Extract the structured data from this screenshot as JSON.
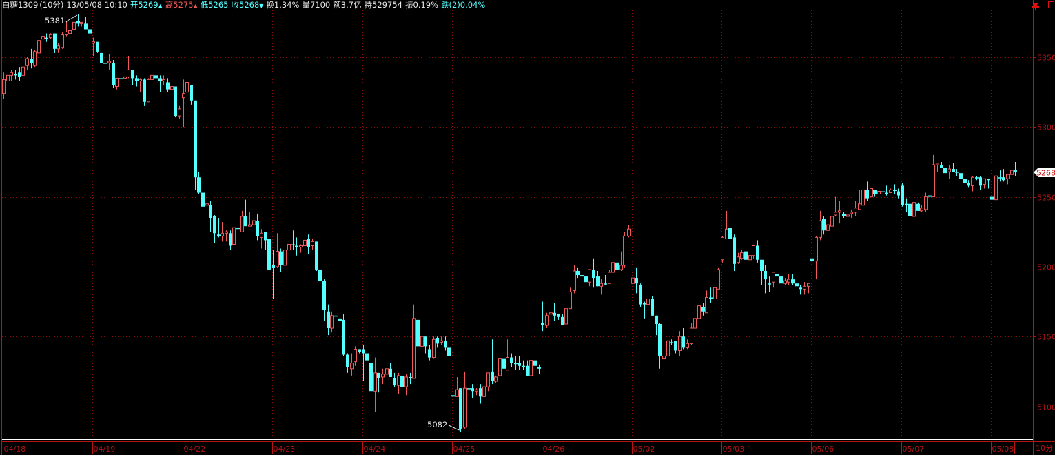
{
  "header": {
    "symbol": "白糖1309",
    "period": "(10分)",
    "datetime": "13/05/08 10:10",
    "open": "开5269",
    "high": "高5275",
    "low": "低5265",
    "close": "收5268",
    "turnover_rate": "换1.34%",
    "volume": "量7100",
    "amount": "额3.7亿",
    "open_interest": "持529754",
    "amplitude": "振0.19%",
    "change": "跌(2)0.04%"
  },
  "period_label": "10分",
  "current_price_tag": "5268",
  "icons": [
    "pin-icon",
    "window-icon"
  ],
  "colors": {
    "up": "#f05a5a",
    "down": "#54ffff",
    "grid": "#8a0d0d",
    "axis": "#b41414",
    "background": "#000000"
  },
  "chart_data": {
    "type": "candlestick",
    "title": "",
    "x_tick_labels": [
      "04/18",
      "04/19",
      "04/22",
      "04/23",
      "04/24",
      "04/25",
      "04/26",
      "05/02",
      "05/03",
      "05/06",
      "05/07",
      "05/08"
    ],
    "bars_per_day": 23,
    "y_tick_labels": [
      "5350",
      "5300",
      "5250",
      "5200",
      "5150",
      "5100"
    ],
    "ylim": [
      5076,
      5384
    ],
    "grid": true,
    "annotations": {
      "max_label": "5381",
      "min_label": "5082"
    },
    "ohlc_fields": [
      "open",
      "high",
      "low",
      "close"
    ],
    "candles": [
      [
        5324,
        5339,
        5320,
        5334
      ],
      [
        5333,
        5342,
        5328,
        5337
      ],
      [
        5337,
        5341,
        5333,
        5339
      ],
      [
        5338,
        5341,
        5334,
        5337
      ],
      [
        5339,
        5343,
        5333,
        5336
      ],
      [
        5337,
        5344,
        5336,
        5343
      ],
      [
        5344,
        5350,
        5341,
        5349
      ],
      [
        5349,
        5356,
        5342,
        5346
      ],
      [
        5344,
        5355,
        5343,
        5354
      ],
      [
        5353,
        5367,
        5352,
        5362
      ],
      [
        5363,
        5372,
        5362,
        5365
      ],
      [
        5364,
        5367,
        5361,
        5364
      ],
      [
        5364,
        5367,
        5363,
        5366
      ],
      [
        5367,
        5367,
        5353,
        5356
      ],
      [
        5356,
        5360,
        5353,
        5358
      ],
      [
        5357,
        5368,
        5356,
        5366
      ],
      [
        5366,
        5376,
        5365,
        5368
      ],
      [
        5367,
        5370,
        5367,
        5369
      ],
      [
        5370,
        5379,
        5369,
        5375
      ],
      [
        5376,
        5381,
        5372,
        5374
      ],
      [
        5374,
        5375,
        5372,
        5375
      ],
      [
        5374,
        5379,
        5370,
        5370
      ],
      [
        5370,
        5371,
        5366,
        5367
      ],
      [
        5360,
        5364,
        5351,
        5361
      ],
      [
        5361,
        5361,
        5353,
        5354
      ],
      [
        5353,
        5353,
        5346,
        5346
      ],
      [
        5346,
        5349,
        5343,
        5346
      ],
      [
        5346,
        5352,
        5341,
        5347
      ],
      [
        5346,
        5348,
        5328,
        5330
      ],
      [
        5329,
        5335,
        5327,
        5335
      ],
      [
        5335,
        5339,
        5334,
        5335
      ],
      [
        5335,
        5337,
        5329,
        5336
      ],
      [
        5336,
        5351,
        5335,
        5341
      ],
      [
        5341,
        5341,
        5330,
        5335
      ],
      [
        5335,
        5337,
        5329,
        5333
      ],
      [
        5333,
        5335,
        5325,
        5334
      ],
      [
        5334,
        5335,
        5315,
        5318
      ],
      [
        5318,
        5335,
        5318,
        5334
      ],
      [
        5334,
        5337,
        5327,
        5337
      ],
      [
        5337,
        5339,
        5333,
        5335
      ],
      [
        5335,
        5337,
        5325,
        5333
      ],
      [
        5333,
        5337,
        5330,
        5334
      ],
      [
        5332,
        5335,
        5325,
        5327
      ],
      [
        5327,
        5330,
        5324,
        5329
      ],
      [
        5329,
        5329,
        5307,
        5308
      ],
      [
        5308,
        5315,
        5306,
        5313
      ],
      [
        5321,
        5334,
        5300,
        5324
      ],
      [
        5325,
        5334,
        5324,
        5332
      ],
      [
        5330,
        5330,
        5316,
        5319
      ],
      [
        5319,
        5319,
        5255,
        5264
      ],
      [
        5264,
        5268,
        5252,
        5253
      ],
      [
        5253,
        5258,
        5242,
        5243
      ],
      [
        5244,
        5253,
        5237,
        5245
      ],
      [
        5244,
        5247,
        5225,
        5235
      ],
      [
        5236,
        5237,
        5217,
        5224
      ],
      [
        5223,
        5235,
        5221,
        5222
      ],
      [
        5222,
        5232,
        5218,
        5224
      ],
      [
        5224,
        5226,
        5218,
        5225
      ],
      [
        5224,
        5226,
        5212,
        5215
      ],
      [
        5216,
        5229,
        5209,
        5228
      ],
      [
        5228,
        5237,
        5224,
        5227
      ],
      [
        5225,
        5240,
        5225,
        5236
      ],
      [
        5236,
        5248,
        5229,
        5229
      ],
      [
        5229,
        5239,
        5229,
        5230
      ],
      [
        5230,
        5238,
        5228,
        5233
      ],
      [
        5233,
        5238,
        5219,
        5222
      ],
      [
        5221,
        5227,
        5213,
        5224
      ],
      [
        5225,
        5225,
        5212,
        5219
      ],
      [
        5220,
        5221,
        5196,
        5198
      ],
      [
        5201,
        5212,
        5177,
        5199
      ],
      [
        5200,
        5224,
        5199,
        5211
      ],
      [
        5211,
        5213,
        5196,
        5201
      ],
      [
        5201,
        5220,
        5195,
        5212
      ],
      [
        5212,
        5216,
        5210,
        5216
      ],
      [
        5216,
        5226,
        5212,
        5216
      ],
      [
        5215,
        5221,
        5208,
        5214
      ],
      [
        5214,
        5216,
        5210,
        5215
      ],
      [
        5215,
        5219,
        5215,
        5219
      ],
      [
        5220,
        5223,
        5209,
        5214
      ],
      [
        5215,
        5220,
        5212,
        5218
      ],
      [
        5218,
        5218,
        5197,
        5198
      ],
      [
        5198,
        5204,
        5186,
        5190
      ],
      [
        5190,
        5191,
        5161,
        5169
      ],
      [
        5168,
        5173,
        5151,
        5156
      ],
      [
        5156,
        5168,
        5153,
        5165
      ],
      [
        5165,
        5168,
        5156,
        5165
      ],
      [
        5163,
        5166,
        5160,
        5161
      ],
      [
        5162,
        5166,
        5136,
        5137
      ],
      [
        5137,
        5138,
        5124,
        5128
      ],
      [
        5127,
        5138,
        5122,
        5131
      ],
      [
        5132,
        5143,
        5129,
        5141
      ],
      [
        5141,
        5141,
        5138,
        5139
      ],
      [
        5141,
        5144,
        5118,
        5138
      ],
      [
        5138,
        5149,
        5133,
        5133
      ],
      [
        5131,
        5135,
        5100,
        5111
      ],
      [
        5111,
        5135,
        5096,
        5124
      ],
      [
        5124,
        5124,
        5110,
        5120
      ],
      [
        5121,
        5127,
        5116,
        5123
      ],
      [
        5123,
        5136,
        5122,
        5127
      ],
      [
        5127,
        5131,
        5121,
        5121
      ],
      [
        5120,
        5124,
        5114,
        5115
      ],
      [
        5115,
        5124,
        5109,
        5122
      ],
      [
        5122,
        5124,
        5109,
        5114
      ],
      [
        5114,
        5123,
        5108,
        5121
      ],
      [
        5121,
        5124,
        5116,
        5120
      ],
      [
        5120,
        5173,
        5120,
        5163
      ],
      [
        5162,
        5177,
        5130,
        5143
      ],
      [
        5143,
        5155,
        5142,
        5150
      ],
      [
        5150,
        5150,
        5138,
        5143
      ],
      [
        5141,
        5144,
        5133,
        5135
      ],
      [
        5135,
        5150,
        5134,
        5148
      ],
      [
        5149,
        5150,
        5142,
        5145
      ],
      [
        5146,
        5150,
        5144,
        5147
      ],
      [
        5147,
        5150,
        5140,
        5142
      ],
      [
        5142,
        5142,
        5133,
        5136
      ],
      [
        5108,
        5120,
        5096,
        5107
      ],
      [
        5107,
        5121,
        5107,
        5112
      ],
      [
        5113,
        5113,
        5082,
        5084
      ],
      [
        5085,
        5125,
        5084,
        5113
      ],
      [
        5113,
        5120,
        5106,
        5113
      ],
      [
        5113,
        5116,
        5106,
        5111
      ],
      [
        5111,
        5113,
        5108,
        5112
      ],
      [
        5113,
        5116,
        5102,
        5107
      ],
      [
        5107,
        5118,
        5107,
        5114
      ],
      [
        5114,
        5124,
        5111,
        5124
      ],
      [
        5125,
        5148,
        5116,
        5118
      ],
      [
        5118,
        5122,
        5117,
        5121
      ],
      [
        5122,
        5134,
        5120,
        5134
      ],
      [
        5134,
        5137,
        5120,
        5127
      ],
      [
        5126,
        5148,
        5126,
        5135
      ],
      [
        5135,
        5138,
        5128,
        5131
      ],
      [
        5131,
        5136,
        5126,
        5131
      ],
      [
        5131,
        5136,
        5126,
        5129
      ],
      [
        5129,
        5133,
        5126,
        5128
      ],
      [
        5129,
        5133,
        5122,
        5122
      ],
      [
        5122,
        5133,
        5122,
        5133
      ],
      [
        5133,
        5136,
        5128,
        5129
      ],
      [
        5128,
        5130,
        5123,
        5127
      ],
      [
        5160,
        5175,
        5154,
        5158
      ],
      [
        5158,
        5167,
        5156,
        5165
      ],
      [
        5166,
        5171,
        5161,
        5167
      ],
      [
        5167,
        5174,
        5161,
        5165
      ],
      [
        5166,
        5166,
        5162,
        5164
      ],
      [
        5164,
        5166,
        5158,
        5158
      ],
      [
        5159,
        5170,
        5155,
        5170
      ],
      [
        5170,
        5185,
        5170,
        5182
      ],
      [
        5183,
        5201,
        5181,
        5197
      ],
      [
        5197,
        5199,
        5192,
        5194
      ],
      [
        5194,
        5207,
        5192,
        5193
      ],
      [
        5193,
        5196,
        5186,
        5189
      ],
      [
        5189,
        5198,
        5186,
        5198
      ],
      [
        5198,
        5206,
        5185,
        5192
      ],
      [
        5193,
        5197,
        5186,
        5186
      ],
      [
        5186,
        5191,
        5180,
        5188
      ],
      [
        5188,
        5194,
        5187,
        5188
      ],
      [
        5188,
        5198,
        5188,
        5196
      ],
      [
        5196,
        5205,
        5195,
        5203
      ],
      [
        5203,
        5203,
        5193,
        5198
      ],
      [
        5198,
        5211,
        5197,
        5201
      ],
      [
        5201,
        5225,
        5199,
        5222
      ],
      [
        5222,
        5230,
        5221,
        5227
      ],
      [
        5188,
        5199,
        5173,
        5192
      ],
      [
        5192,
        5199,
        5181,
        5188
      ],
      [
        5187,
        5188,
        5171,
        5173
      ],
      [
        5174,
        5175,
        5163,
        5173
      ],
      [
        5173,
        5182,
        5169,
        5177
      ],
      [
        5177,
        5179,
        5165,
        5165
      ],
      [
        5165,
        5165,
        5151,
        5159
      ],
      [
        5159,
        5160,
        5127,
        5136
      ],
      [
        5134,
        5143,
        5130,
        5136
      ],
      [
        5136,
        5149,
        5135,
        5147
      ],
      [
        5146,
        5148,
        5144,
        5146
      ],
      [
        5147,
        5147,
        5138,
        5140
      ],
      [
        5140,
        5154,
        5136,
        5150
      ],
      [
        5150,
        5156,
        5141,
        5142
      ],
      [
        5142,
        5148,
        5141,
        5145
      ],
      [
        5145,
        5160,
        5144,
        5156
      ],
      [
        5156,
        5168,
        5155,
        5163
      ],
      [
        5163,
        5176,
        5161,
        5172
      ],
      [
        5171,
        5174,
        5165,
        5168
      ],
      [
        5167,
        5183,
        5167,
        5178
      ],
      [
        5178,
        5185,
        5174,
        5177
      ],
      [
        5177,
        5185,
        5177,
        5185
      ],
      [
        5184,
        5199,
        5184,
        5198
      ],
      [
        5205,
        5222,
        5203,
        5221
      ],
      [
        5220,
        5240,
        5220,
        5227
      ],
      [
        5228,
        5230,
        5219,
        5220
      ],
      [
        5221,
        5223,
        5197,
        5202
      ],
      [
        5203,
        5210,
        5202,
        5207
      ],
      [
        5206,
        5212,
        5205,
        5210
      ],
      [
        5211,
        5212,
        5201,
        5205
      ],
      [
        5205,
        5208,
        5190,
        5208
      ],
      [
        5208,
        5215,
        5206,
        5215
      ],
      [
        5215,
        5219,
        5203,
        5205
      ],
      [
        5205,
        5205,
        5187,
        5197
      ],
      [
        5197,
        5201,
        5181,
        5191
      ],
      [
        5188,
        5193,
        5182,
        5188
      ],
      [
        5189,
        5196,
        5185,
        5196
      ],
      [
        5195,
        5199,
        5190,
        5193
      ],
      [
        5193,
        5195,
        5187,
        5188
      ],
      [
        5188,
        5192,
        5187,
        5190
      ],
      [
        5189,
        5195,
        5187,
        5191
      ],
      [
        5191,
        5195,
        5187,
        5188
      ],
      [
        5188,
        5190,
        5180,
        5186
      ],
      [
        5185,
        5187,
        5180,
        5184
      ],
      [
        5184,
        5189,
        5180,
        5186
      ],
      [
        5186,
        5188,
        5181,
        5188
      ],
      [
        5206,
        5217,
        5182,
        5204
      ],
      [
        5204,
        5222,
        5191,
        5221
      ],
      [
        5221,
        5240,
        5219,
        5233
      ],
      [
        5234,
        5236,
        5223,
        5226
      ],
      [
        5226,
        5231,
        5223,
        5230
      ],
      [
        5229,
        5245,
        5228,
        5236
      ],
      [
        5237,
        5250,
        5236,
        5239
      ],
      [
        5239,
        5247,
        5231,
        5240
      ],
      [
        5238,
        5239,
        5235,
        5236
      ],
      [
        5236,
        5238,
        5235,
        5237
      ],
      [
        5238,
        5241,
        5235,
        5239
      ],
      [
        5239,
        5247,
        5236,
        5242
      ],
      [
        5241,
        5255,
        5241,
        5245
      ],
      [
        5244,
        5258,
        5244,
        5255
      ],
      [
        5255,
        5261,
        5247,
        5249
      ],
      [
        5250,
        5256,
        5250,
        5256
      ],
      [
        5255,
        5255,
        5250,
        5252
      ],
      [
        5252,
        5256,
        5250,
        5254
      ],
      [
        5254,
        5255,
        5250,
        5254
      ],
      [
        5253,
        5258,
        5251,
        5253
      ],
      [
        5253,
        5256,
        5253,
        5255
      ],
      [
        5255,
        5259,
        5252,
        5255
      ],
      [
        5254,
        5256,
        5249,
        5251
      ],
      [
        5258,
        5260,
        5243,
        5244
      ],
      [
        5245,
        5249,
        5239,
        5245
      ],
      [
        5245,
        5246,
        5233,
        5236
      ],
      [
        5236,
        5249,
        5235,
        5246
      ],
      [
        5245,
        5246,
        5240,
        5240
      ],
      [
        5240,
        5244,
        5239,
        5242
      ],
      [
        5241,
        5253,
        5239,
        5250
      ],
      [
        5251,
        5255,
        5248,
        5250
      ],
      [
        5250,
        5280,
        5250,
        5273
      ],
      [
        5273,
        5274,
        5268,
        5274
      ],
      [
        5273,
        5275,
        5271,
        5271
      ],
      [
        5271,
        5276,
        5264,
        5267
      ],
      [
        5268,
        5273,
        5263,
        5270
      ],
      [
        5270,
        5274,
        5268,
        5268
      ],
      [
        5268,
        5270,
        5265,
        5268
      ],
      [
        5267,
        5267,
        5260,
        5263
      ],
      [
        5263,
        5263,
        5255,
        5260
      ],
      [
        5260,
        5262,
        5257,
        5258
      ],
      [
        5258,
        5265,
        5254,
        5264
      ],
      [
        5264,
        5265,
        5262,
        5264
      ],
      [
        5264,
        5265,
        5255,
        5258
      ],
      [
        5259,
        5263,
        5256,
        5263
      ],
      [
        5263,
        5263,
        5256,
        5262
      ],
      [
        5250,
        5256,
        5242,
        5248
      ],
      [
        5248,
        5280,
        5248,
        5265
      ],
      [
        5264,
        5269,
        5261,
        5264
      ],
      [
        5264,
        5270,
        5261,
        5262
      ],
      [
        5263,
        5266,
        5259,
        5266
      ],
      [
        5266,
        5274,
        5265,
        5269
      ],
      [
        5269,
        5275,
        5265,
        5268
      ]
    ]
  }
}
